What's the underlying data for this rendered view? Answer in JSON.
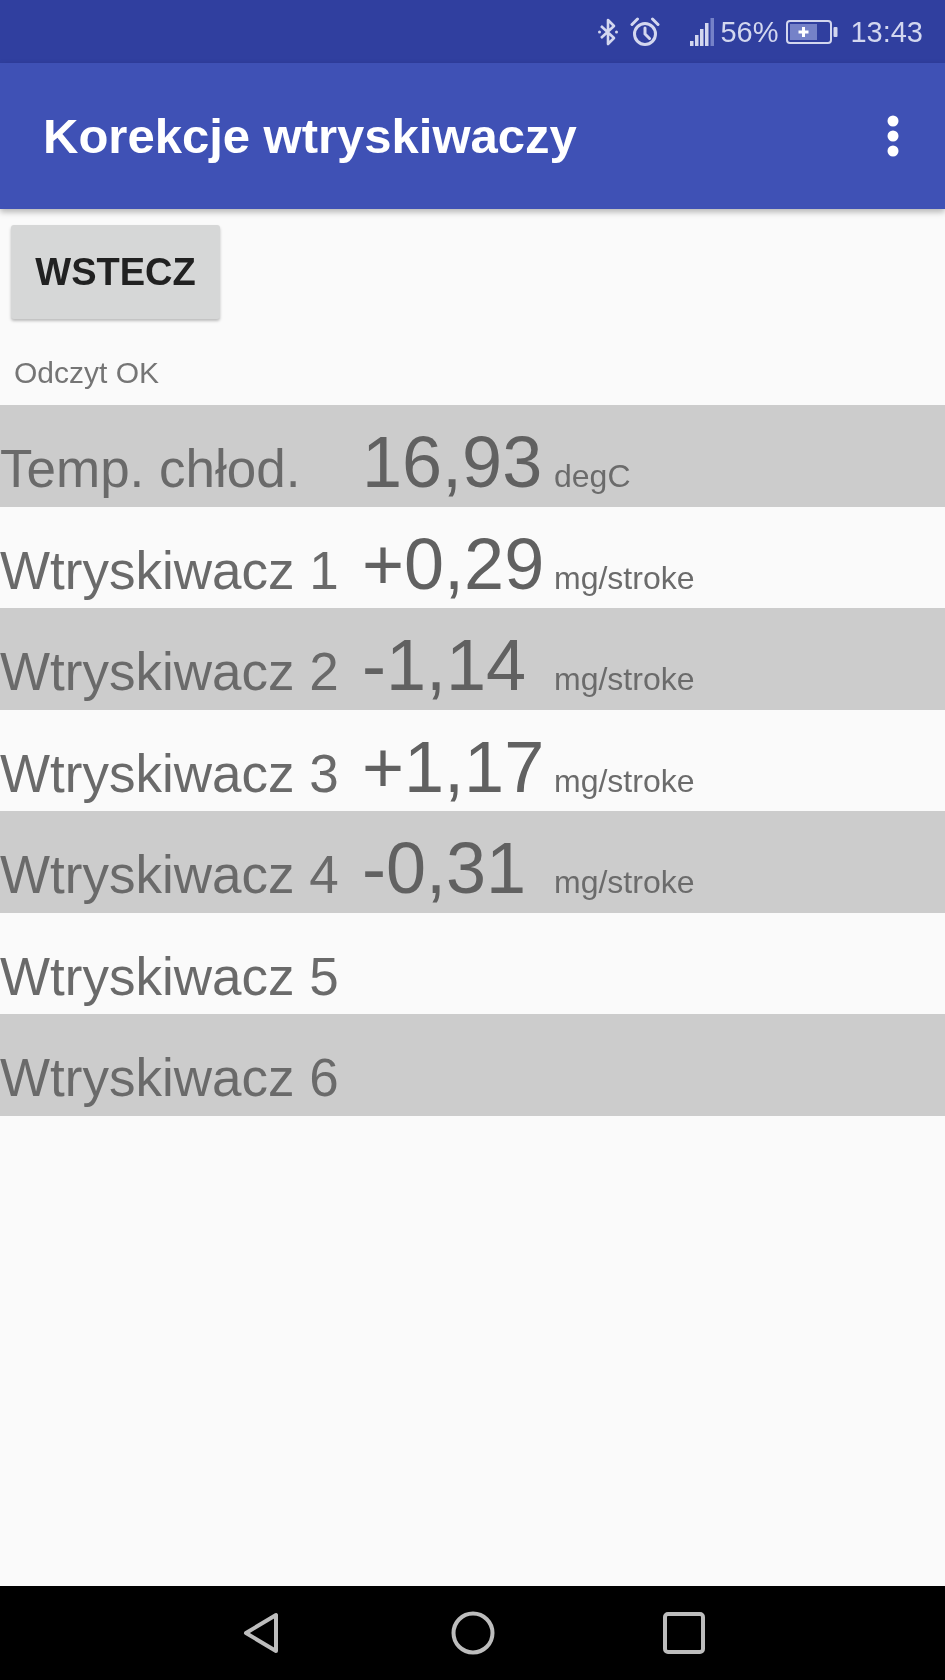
{
  "status_bar": {
    "battery": "56%",
    "time": "13:43"
  },
  "app_bar": {
    "title": "Korekcje wtryskiwaczy"
  },
  "back_button": {
    "label": "WSTECZ"
  },
  "status_text": "Odczyt OK",
  "readings": [
    {
      "label": "Temp. chłod.",
      "value": "16,93",
      "unit": "degC"
    },
    {
      "label": "Wtryskiwacz 1",
      "value": "+0,29",
      "unit": "mg/stroke"
    },
    {
      "label": "Wtryskiwacz 2",
      "value": "-1,14",
      "unit": "mg/stroke"
    },
    {
      "label": "Wtryskiwacz 3",
      "value": "+1,17",
      "unit": "mg/stroke"
    },
    {
      "label": "Wtryskiwacz 4",
      "value": "-0,31",
      "unit": "mg/stroke"
    },
    {
      "label": "Wtryskiwacz 5"
    },
    {
      "label": "Wtryskiwacz 6"
    }
  ]
}
